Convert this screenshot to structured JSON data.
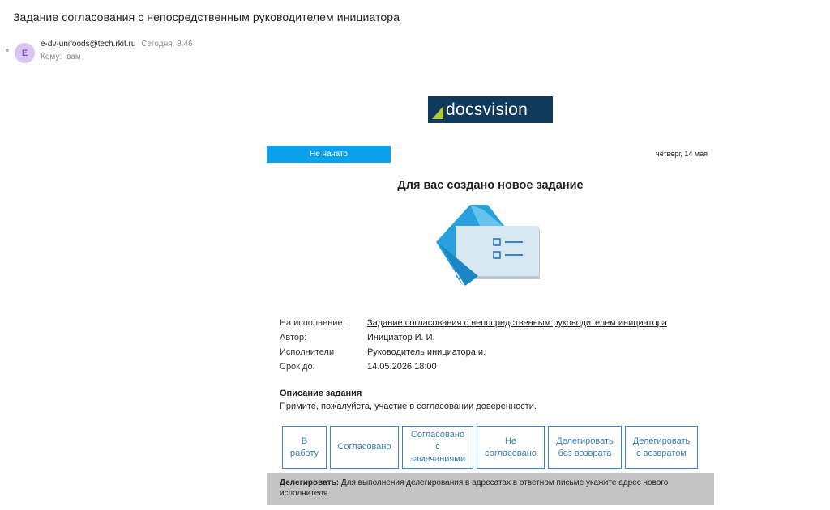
{
  "email": {
    "subject": "Задание согласования с непосредственным руководителем инициатора",
    "avatar_letter": "E",
    "sender": "e-dv-unifoods@tech.rkit.ru",
    "time": "Сегодня, 8:46",
    "to_label": "Кому:",
    "to_value": "вам"
  },
  "logo": {
    "text": "docsvision"
  },
  "status": {
    "label": "Не начато",
    "date": "четверг, 14 мая"
  },
  "headline": "Для вас создано новое задание",
  "details": {
    "rows": [
      {
        "label": "На исполнение:",
        "value": "Задание согласования с непосредственным руководителем инициатора"
      },
      {
        "label": "Автор:",
        "value": "Инициатор И. И."
      },
      {
        "label": "Исполнители",
        "value": "Руководитель инициатора и."
      },
      {
        "label": "Срок до:",
        "value": "14.05.2026 18:00"
      }
    ]
  },
  "description": {
    "title": "Описание задания",
    "text": "Примите, пожалуйста, участие в согласовании доверенности."
  },
  "actions": {
    "in_work": [
      "В",
      "работу"
    ],
    "approved": [
      "Согласовано"
    ],
    "approved_remarks": [
      "Согласовано",
      "с",
      "замечаниями"
    ],
    "not_approved": [
      "Не",
      "согласовано"
    ],
    "delegate_no_return": [
      "Делегировать",
      "без возврата"
    ],
    "delegate_return": [
      "Делегировать",
      "с возвратом"
    ]
  },
  "note": {
    "bold": "Делегировать:",
    "text": " Для выполнения делегирования в адресатах в ответном письме укажите адрес нового исполнителя"
  },
  "colors": {
    "status_blue": "#0aa2ec",
    "logo_bg": "#0f3a5c",
    "button_border": "#3c8ab9",
    "note_bg": "#c4c4c4"
  }
}
